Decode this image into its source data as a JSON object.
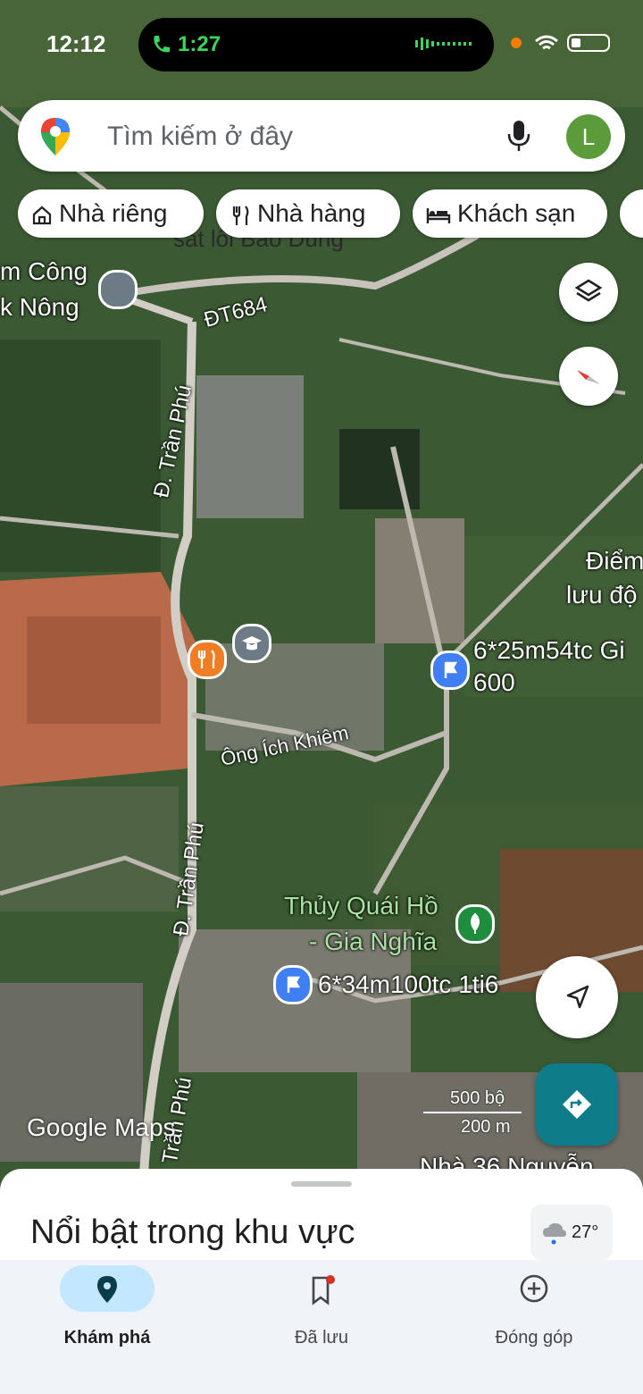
{
  "status": {
    "time": "12:12",
    "call_duration": "1:27"
  },
  "search": {
    "placeholder": "Tìm kiếm ở đây",
    "avatar_letter": "L"
  },
  "chips": [
    {
      "label": "Nhà riêng",
      "icon": "home-icon"
    },
    {
      "label": "Nhà hàng",
      "icon": "restaurant-icon"
    },
    {
      "label": "Khách sạn",
      "icon": "hotel-icon"
    }
  ],
  "map_labels": {
    "behind_chips": "sát lối Bảo Dũng",
    "top_left_1": "m Công",
    "top_left_2": "k Nông",
    "road_dt684": "ĐT684",
    "road_tranphu_1": "Đ. Trần Phú",
    "road_tranphu_2": "Đ. Trần Phú",
    "road_tranphu_3": "Trần Phú",
    "road_ichkhiem": "Ông Ích Khiêm",
    "poi_right_1": "Điểm",
    "poi_right_2": "lưu độ",
    "listing_1a": "6*25m54tc Gi",
    "listing_1b": "600",
    "lake_1": "Thủy Quái Hồ",
    "lake_2": "- Gia Nghĩa",
    "listing_2": "6*34m100tc 1ti6",
    "bottom_place": "Nhà 36 Nguyễn",
    "logo": "Google Maps",
    "scale_top": "500 bộ",
    "scale_bottom": "200 m"
  },
  "sheet": {
    "title": "Nổi bật trong khu vực",
    "temperature": "27°"
  },
  "nav": [
    {
      "label": "Khám phá",
      "icon": "explore-pin-icon",
      "active": true
    },
    {
      "label": "Đã lưu",
      "icon": "bookmark-icon",
      "active": false
    },
    {
      "label": "Đóng góp",
      "icon": "add-circle-icon",
      "active": false
    }
  ],
  "colors": {
    "accent_teal": "#0f7c8a",
    "active_nav_bg": "#c2e7ff",
    "pin_blue": "#3f7ef3",
    "pin_orange": "#f07c24",
    "pin_green": "#1e8e3e"
  }
}
